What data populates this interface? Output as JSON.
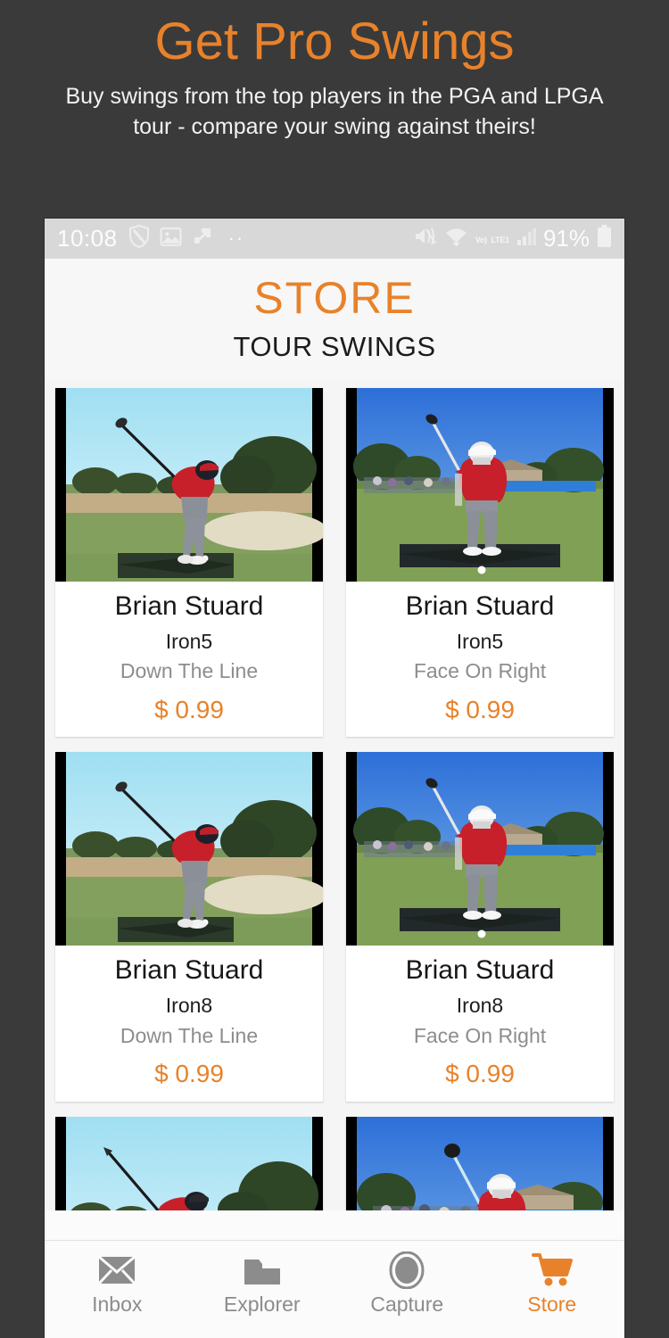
{
  "promo": {
    "title": "Get Pro Swings",
    "subtitle": "Buy swings from the top players in the PGA and LPGA tour - compare your swing against theirs!",
    "title_color": "#E8822A",
    "background_color": "#3a3a3a"
  },
  "statusbar": {
    "time": "10:08",
    "battery_percent": "91%",
    "dots": "··",
    "volte_top": "Vo)",
    "volte_bottom": "LTE1",
    "icons": [
      "shield-icon",
      "photo-icon",
      "app-update-icon",
      "more-dots-icon",
      "vibrate-icon",
      "wifi-icon",
      "volte-icon",
      "signal-bars-icon",
      "battery-icon"
    ]
  },
  "header": {
    "title": "STORE",
    "subtitle": "TOUR SWINGS",
    "accent_color": "#E8822A"
  },
  "products": [
    {
      "name": "Brian Stuard",
      "club": "Iron5",
      "view": "Down The Line",
      "price": "$ 0.99",
      "thumb": "down-the-line"
    },
    {
      "name": "Brian Stuard",
      "club": "Iron5",
      "view": "Face On Right",
      "price": "$ 0.99",
      "thumb": "face-on"
    },
    {
      "name": "Brian Stuard",
      "club": "Iron8",
      "view": "Down The Line",
      "price": "$ 0.99",
      "thumb": "down-the-line"
    },
    {
      "name": "Brian Stuard",
      "club": "Iron8",
      "view": "Face On Right",
      "price": "$ 0.99",
      "thumb": "face-on"
    },
    {
      "name": "",
      "club": "",
      "view": "",
      "price": "",
      "thumb": "down-the-line-2"
    },
    {
      "name": "",
      "club": "",
      "view": "",
      "price": "",
      "thumb": "face-on-2"
    }
  ],
  "bottomnav": {
    "items": [
      {
        "label": "Inbox",
        "icon": "envelope-icon",
        "active": false
      },
      {
        "label": "Explorer",
        "icon": "folder-icon",
        "active": false
      },
      {
        "label": "Capture",
        "icon": "camera-lens-icon",
        "active": false
      },
      {
        "label": "Store",
        "icon": "shopping-cart-icon",
        "active": true
      }
    ],
    "active_color": "#E8822A",
    "inactive_color": "#8c8c8c"
  }
}
